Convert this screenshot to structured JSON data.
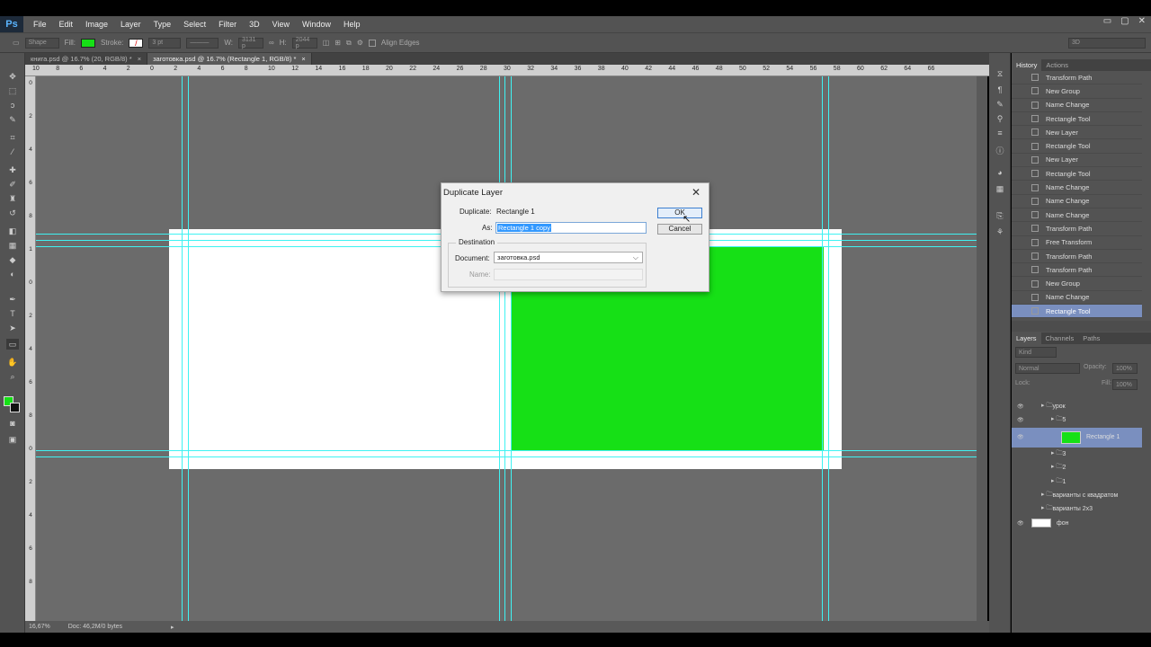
{
  "menubar": {
    "logo": "Ps",
    "items": [
      "File",
      "Edit",
      "Image",
      "Layer",
      "Type",
      "Select",
      "Filter",
      "3D",
      "View",
      "Window",
      "Help"
    ],
    "window_controls": [
      "▭",
      "▢",
      "✕"
    ]
  },
  "options": {
    "shape_mode": "Shape",
    "fill_label": "Fill:",
    "stroke_label": "Stroke:",
    "stroke_size": "3 pt",
    "w_label": "W:",
    "w_value": "3131 p",
    "h_label": "H:",
    "h_value": "2044 p",
    "align_edges": "Align Edges",
    "workspace": "3D",
    "fill_color": "#16e016"
  },
  "tabs": [
    {
      "label": "книга.psd @ 16.7% (20, RGB/8) *",
      "close": "×"
    },
    {
      "label": "заготовка.psd @ 16.7% (Rectangle 1, RGB/8) *",
      "close": "×"
    }
  ],
  "ruler_top": [
    "10",
    "8",
    "6",
    "4",
    "2",
    "0",
    "2",
    "4",
    "6",
    "8",
    "10",
    "12",
    "14",
    "16",
    "18",
    "20",
    "22",
    "24",
    "26",
    "28",
    "30",
    "32",
    "34",
    "36",
    "38",
    "40",
    "42",
    "44",
    "46",
    "48",
    "50",
    "52",
    "54",
    "56",
    "58",
    "60",
    "62",
    "64",
    "66"
  ],
  "ruler_left": [
    "0",
    "2",
    "4",
    "6",
    "8",
    "1",
    "0",
    "2",
    "4",
    "6",
    "8",
    "0",
    "2",
    "4",
    "6",
    "8"
  ],
  "status": {
    "zoom": "16,67%",
    "doc": "Doc: 46,2M/0 bytes"
  },
  "dialog": {
    "title": "Duplicate Layer",
    "close": "✕",
    "duplicate_label": "Duplicate:",
    "duplicate_value": "Rectangle 1",
    "as_label": "As:",
    "as_value": "Rectangle 1 copy",
    "destination": "Destination",
    "document_label": "Document:",
    "document_value": "заготовка.psd",
    "name_label": "Name:",
    "ok": "OK",
    "cancel": "Cancel"
  },
  "history": {
    "tabs": [
      "History",
      "Actions"
    ],
    "items": [
      "Transform Path",
      "New Group",
      "Name Change",
      "Rectangle Tool",
      "New Layer",
      "Rectangle Tool",
      "New Layer",
      "Rectangle Tool",
      "Name Change",
      "Name Change",
      "Name Change",
      "Transform Path",
      "Free Transform",
      "Transform Path",
      "Transform Path",
      "New Group",
      "Name Change",
      "Rectangle Tool"
    ]
  },
  "layers": {
    "tabs": [
      "Layers",
      "Channels",
      "Paths"
    ],
    "kind": "Kind",
    "blend_mode": "Normal",
    "opacity_label": "Opacity:",
    "opacity": "100%",
    "lock_label": "Lock:",
    "fill_label": "Fill:",
    "fill": "100%",
    "items": [
      {
        "name": "урок",
        "indent": 1,
        "eye": true,
        "folder": true
      },
      {
        "name": "5",
        "indent": 2,
        "eye": true,
        "folder": true
      },
      {
        "name": "Rectangle 1",
        "indent": 3,
        "eye": true,
        "thumb": "green"
      },
      {
        "name": "3",
        "indent": 2,
        "eye": false,
        "folder": true
      },
      {
        "name": "2",
        "indent": 2,
        "eye": false,
        "folder": true
      },
      {
        "name": "1",
        "indent": 2,
        "eye": false,
        "folder": true
      },
      {
        "name": "варианты с квадратом",
        "indent": 1,
        "eye": false,
        "folder": true
      },
      {
        "name": "варианты 2х3",
        "indent": 1,
        "eye": false,
        "folder": true
      },
      {
        "name": "фон",
        "indent": 0,
        "eye": true,
        "thumb": "white"
      }
    ]
  }
}
